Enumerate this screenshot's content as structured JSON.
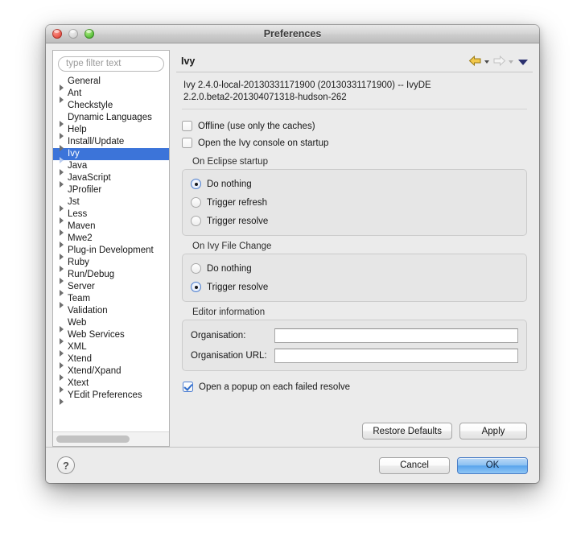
{
  "window": {
    "title": "Preferences",
    "controls": [
      {
        "name": "close",
        "color": "#e8564a"
      },
      {
        "name": "minimize",
        "color": "#d6d6d6"
      },
      {
        "name": "zoom",
        "color": "#5bc13d"
      }
    ]
  },
  "filter": {
    "placeholder": "type filter text",
    "value": ""
  },
  "tree": {
    "selected": "Ivy",
    "items": [
      {
        "label": "General",
        "expandable": true
      },
      {
        "label": "Ant",
        "expandable": true
      },
      {
        "label": "Checkstyle",
        "expandable": false
      },
      {
        "label": "Dynamic Languages",
        "expandable": true
      },
      {
        "label": "Help",
        "expandable": true
      },
      {
        "label": "Install/Update",
        "expandable": true
      },
      {
        "label": "Ivy",
        "expandable": true,
        "selected": true
      },
      {
        "label": "Java",
        "expandable": true
      },
      {
        "label": "JavaScript",
        "expandable": true
      },
      {
        "label": "JProfiler",
        "expandable": false
      },
      {
        "label": "Jst",
        "expandable": true
      },
      {
        "label": "Less",
        "expandable": true
      },
      {
        "label": "Maven",
        "expandable": true
      },
      {
        "label": "Mwe2",
        "expandable": true
      },
      {
        "label": "Plug-in Development",
        "expandable": true
      },
      {
        "label": "Ruby",
        "expandable": true
      },
      {
        "label": "Run/Debug",
        "expandable": true
      },
      {
        "label": "Server",
        "expandable": true
      },
      {
        "label": "Team",
        "expandable": true
      },
      {
        "label": "Validation",
        "expandable": false
      },
      {
        "label": "Web",
        "expandable": true
      },
      {
        "label": "Web Services",
        "expandable": true
      },
      {
        "label": "XML",
        "expandable": true
      },
      {
        "label": "Xtend",
        "expandable": true
      },
      {
        "label": "Xtend/Xpand",
        "expandable": true
      },
      {
        "label": "Xtext",
        "expandable": true
      },
      {
        "label": "YEdit Preferences",
        "expandable": true
      }
    ]
  },
  "panel": {
    "title": "Ivy",
    "toolbar": {
      "back_icon": "back-arrow-icon",
      "forward_icon": "forward-arrow-icon",
      "menu_icon": "view-menu-icon"
    },
    "version_line1": "Ivy 2.4.0-local-20130331171900 (20130331171900)  --  IvyDE",
    "version_line2": "2.2.0.beta2-201304071318-hudson-262",
    "offline_checkbox": {
      "label": "Offline (use only the caches)",
      "checked": false
    },
    "console_checkbox": {
      "label": "Open the Ivy console on startup",
      "checked": false
    },
    "startup_group": {
      "label": "On Eclipse startup",
      "options": [
        {
          "label": "Do nothing",
          "selected": true
        },
        {
          "label": "Trigger refresh",
          "selected": false
        },
        {
          "label": "Trigger resolve",
          "selected": false
        }
      ]
    },
    "filechange_group": {
      "label": "On Ivy File Change",
      "options": [
        {
          "label": "Do nothing",
          "selected": false
        },
        {
          "label": "Trigger resolve",
          "selected": true
        }
      ]
    },
    "editor_group": {
      "label": "Editor information",
      "fields": [
        {
          "label": "Organisation:",
          "value": "",
          "placeholder": ""
        },
        {
          "label": "Organisation URL:",
          "value": "",
          "placeholder": ""
        }
      ]
    },
    "popup_checkbox": {
      "label": "Open a popup on each failed resolve",
      "checked": true
    },
    "restore_defaults_label": "Restore Defaults",
    "apply_label": "Apply"
  },
  "footer": {
    "help_glyph": "?",
    "cancel_label": "Cancel",
    "ok_label": "OK"
  },
  "colors": {
    "selection": "#3c74d9",
    "default_button": "#5aa5ec",
    "window_chrome": "#ebebeb"
  }
}
